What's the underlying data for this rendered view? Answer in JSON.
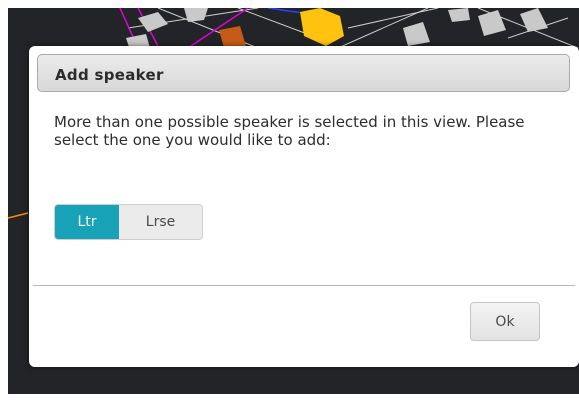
{
  "dialog": {
    "title": "Add speaker",
    "message": "More than one possible speaker is selected in this view. Please select the one you would like to add:",
    "options": [
      {
        "label": "Ltr",
        "selected": true
      },
      {
        "label": "Lrse",
        "selected": false
      }
    ],
    "ok_label": "Ok"
  },
  "colors": {
    "accent": "#17a2b8",
    "viewport_background": "#232427",
    "speaker_highlight": "#ffc20e",
    "speaker_orange": "#c65b17",
    "wire_magenta": "#e000e0"
  }
}
